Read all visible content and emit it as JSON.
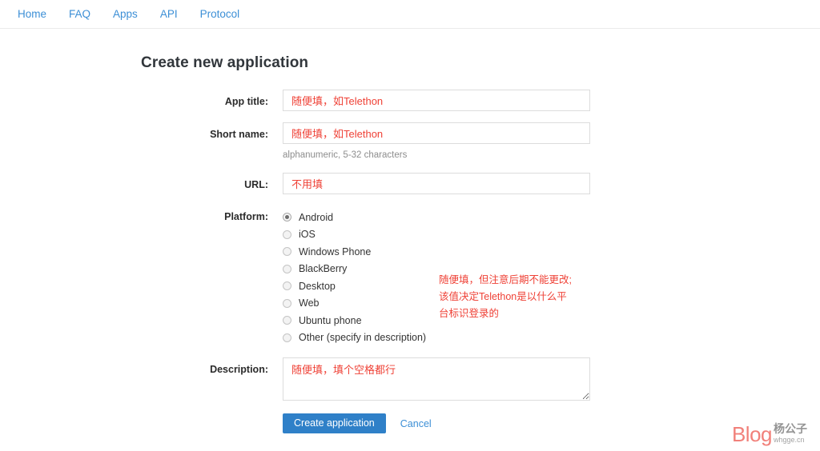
{
  "nav": {
    "items": [
      {
        "label": "Home"
      },
      {
        "label": "FAQ"
      },
      {
        "label": "Apps"
      },
      {
        "label": "API"
      },
      {
        "label": "Protocol"
      }
    ]
  },
  "page": {
    "title": "Create new application"
  },
  "form": {
    "app_title": {
      "label": "App title:",
      "value": "随便填，如Telethon",
      "placeholder": ""
    },
    "short_name": {
      "label": "Short name:",
      "value": "随便填，如Telethon",
      "placeholder": "",
      "hint": "alphanumeric, 5-32 characters"
    },
    "url": {
      "label": "URL:",
      "value": "不用填",
      "placeholder": ""
    },
    "platform": {
      "label": "Platform:",
      "selected": "Android",
      "options": [
        {
          "label": "Android",
          "checked": true
        },
        {
          "label": "iOS",
          "checked": false
        },
        {
          "label": "Windows Phone",
          "checked": false
        },
        {
          "label": "BlackBerry",
          "checked": false
        },
        {
          "label": "Desktop",
          "checked": false
        },
        {
          "label": "Web",
          "checked": false
        },
        {
          "label": "Ubuntu phone",
          "checked": false
        },
        {
          "label": "Other (specify in description)",
          "checked": false
        }
      ]
    },
    "description": {
      "label": "Description:",
      "value": "随便填，填个空格都行",
      "placeholder": ""
    },
    "submit_label": "Create application",
    "cancel_label": "Cancel"
  },
  "annotation": {
    "text": "随便填，但注意后期不能更改;\n该值决定Telethon是以什么平\n台标识登录的",
    "color": "#ef4136"
  },
  "watermark": {
    "blog": "Blog",
    "name": "杨公子",
    "url": "whgge.cn"
  },
  "colors": {
    "link": "#3c8fd6",
    "primary_button": "#2f80c8",
    "annotation_red": "#ef4136",
    "input_border": "#dcdcdc",
    "hint_text": "#8d8d8d"
  }
}
